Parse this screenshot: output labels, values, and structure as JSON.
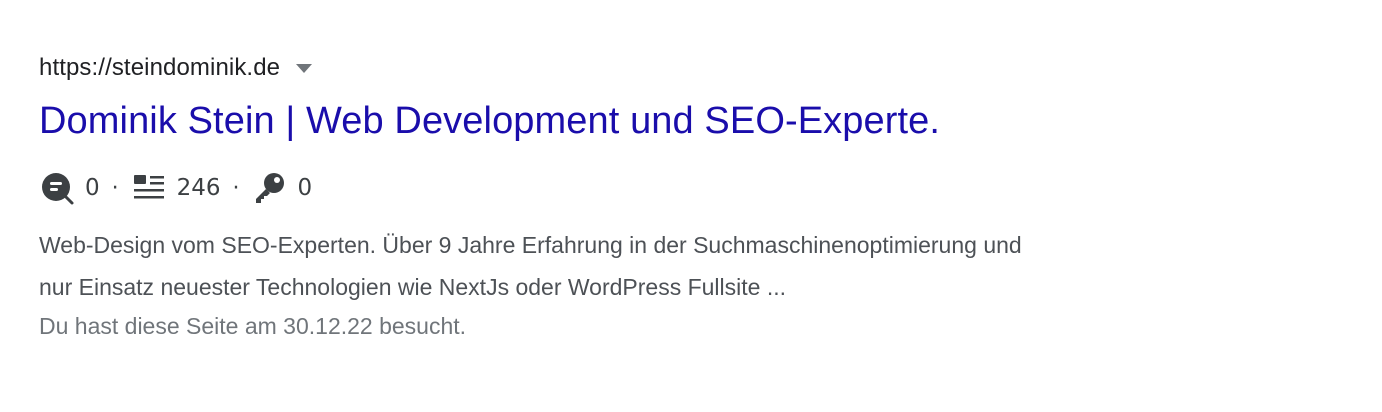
{
  "result": {
    "url": "https://steindominik.de",
    "title": "Dominik Stein | Web Development und SEO-Experte.",
    "stats": {
      "comments": "0",
      "separator1": "·",
      "lines": "246",
      "separator2": "·",
      "keywords": "0"
    },
    "snippet_line1": "Web-Design vom SEO-Experten. Über 9 Jahre Erfahrung in der Suchmaschinenoptimierung und",
    "snippet_line2": "nur Einsatz neuester Technologien wie NextJs oder WordPress Fullsite ...",
    "visited_note": "Du hast diese Seite am 30.12.22 besucht.",
    "icons": [
      "comment-search-icon",
      "list-lines-icon",
      "key-icon",
      "chevron-down-icon"
    ],
    "colors": {
      "title_link": "#1a0dab",
      "url_text": "#202124",
      "snippet_text": "#4d5156",
      "visited_text": "#70757a",
      "icon": "#3c4043"
    }
  }
}
